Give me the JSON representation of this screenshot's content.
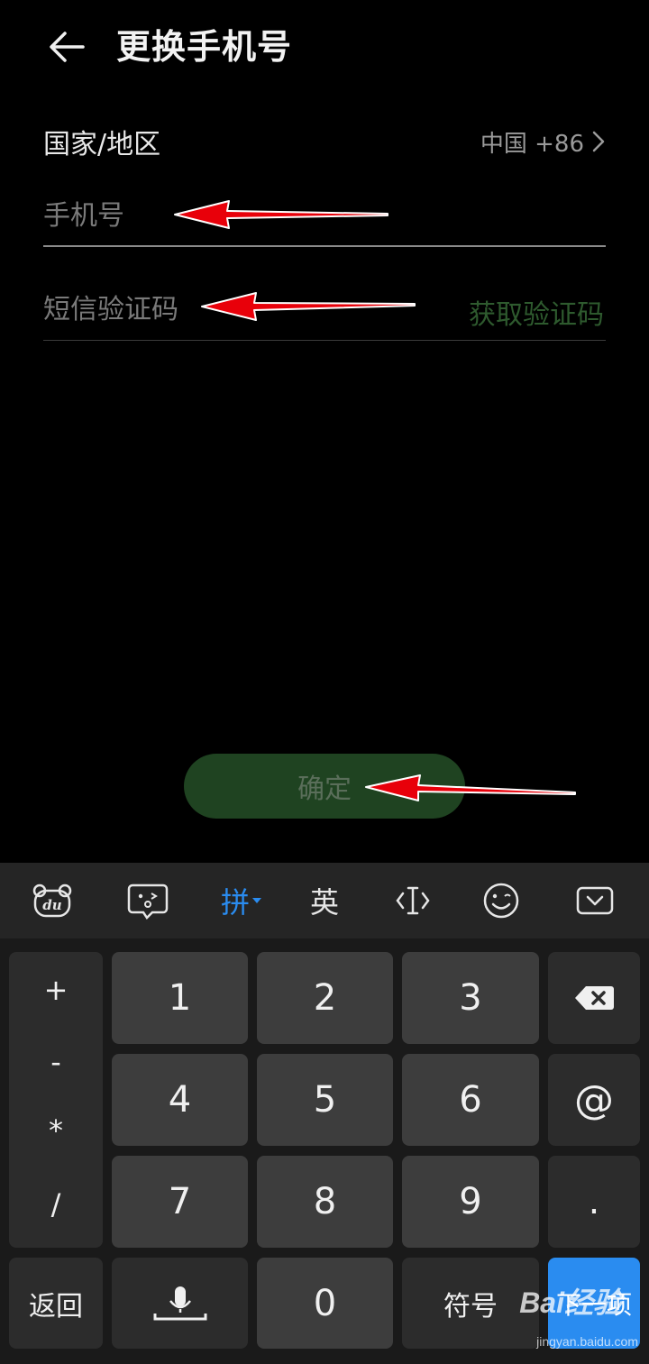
{
  "header": {
    "title": "更换手机号"
  },
  "form": {
    "region_label": "国家/地区",
    "region_value": "中国 +86",
    "phone_placeholder": "手机号",
    "code_placeholder": "短信验证码",
    "get_code_label": "获取验证码",
    "confirm_label": "确定"
  },
  "keyboard": {
    "toolbar": {
      "pinyin_label": "拼",
      "english_label": "英"
    },
    "symbols": [
      "+",
      "-",
      "*",
      "/"
    ],
    "keys": {
      "k1": "1",
      "k2": "2",
      "k3": "3",
      "k4": "4",
      "k5": "5",
      "k6": "6",
      "k7": "7",
      "k8": "8",
      "k9": "9",
      "k0": "0",
      "at": "@",
      "dot": ".",
      "back": "返回",
      "symbol": "符号",
      "next": "下一项"
    }
  },
  "watermark": {
    "brand": "Bai经验",
    "url": "jingyan.baidu.com"
  },
  "colors": {
    "accent_blue": "#2a8cf0",
    "confirm_green": "#1f4321",
    "get_code_green": "#2e5a2e",
    "arrow_red": "#e8000a"
  }
}
